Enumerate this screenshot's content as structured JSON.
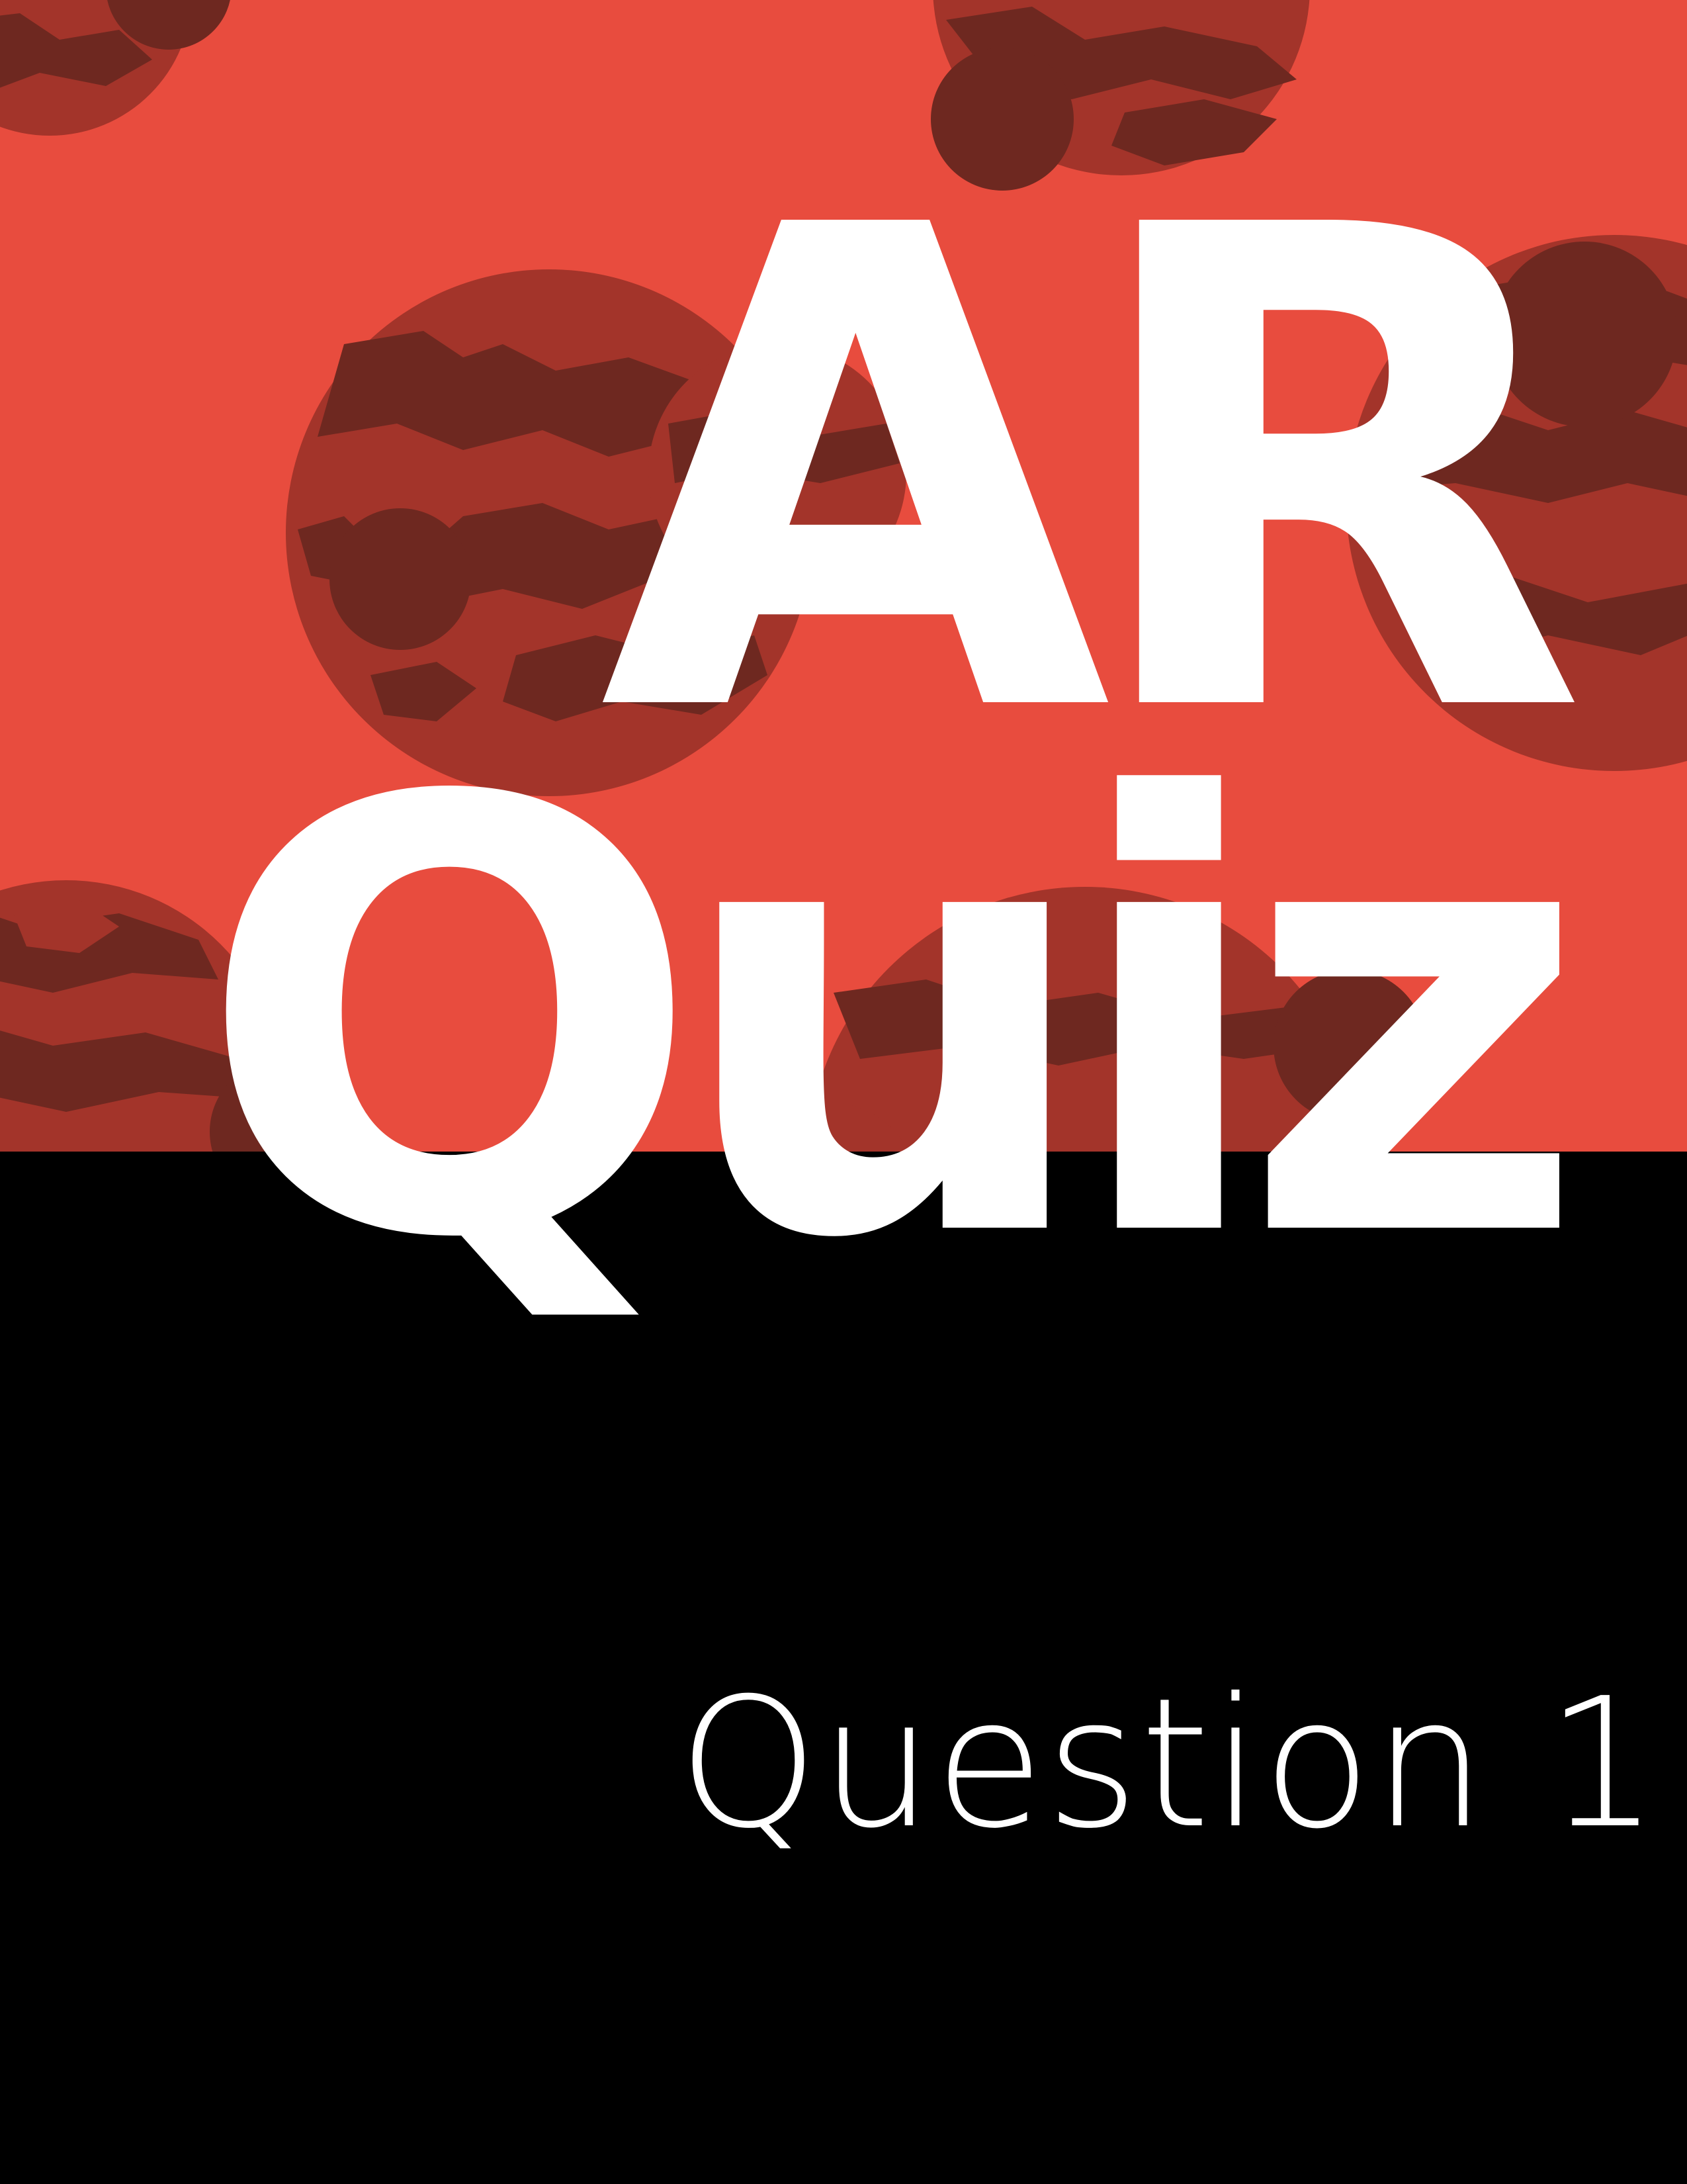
{
  "title": {
    "line1": "AR",
    "line2": "Quiz"
  },
  "subtitle": "Question 1",
  "colors": {
    "background_top": "#e84c3e",
    "background_bottom": "#000000",
    "planet_mid": "#a3342a",
    "planet_dark": "#6e2820",
    "text": "#ffffff"
  },
  "decoration": {
    "icon": "mars-planet-pattern"
  }
}
